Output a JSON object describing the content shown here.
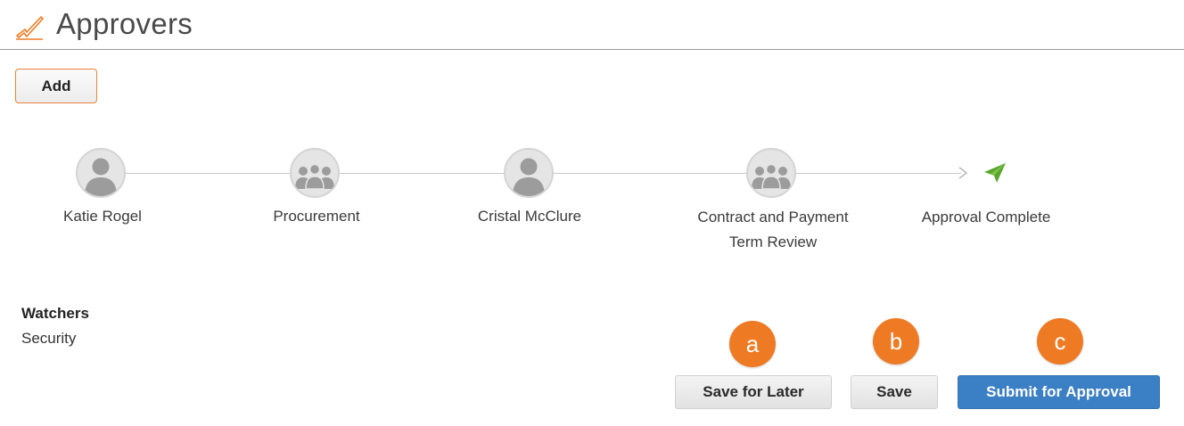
{
  "header": {
    "title": "Approvers",
    "icon": "approval-check-icon"
  },
  "actions": {
    "add_label": "Add"
  },
  "flow": {
    "steps": [
      {
        "label": "Katie Rogel",
        "icon": "user-icon"
      },
      {
        "label": "Procurement",
        "icon": "group-icon"
      },
      {
        "label": "Cristal McClure",
        "icon": "user-icon"
      },
      {
        "label_line1": "Contract and Payment",
        "label_line2": "Term Review",
        "icon": "group-icon"
      }
    ],
    "final": {
      "label": "Approval Complete",
      "icon": "paper-plane-icon"
    }
  },
  "watchers": {
    "title": "Watchers",
    "items": [
      "Security"
    ]
  },
  "footer": {
    "badges": [
      "a",
      "b",
      "c"
    ],
    "save_later_label": "Save for Later",
    "save_label": "Save",
    "submit_label": "Submit for Approval"
  },
  "colors": {
    "accent_orange": "#ee7a23",
    "primary_blue": "#3b7fc4",
    "plane_green": "#5aa52d"
  }
}
